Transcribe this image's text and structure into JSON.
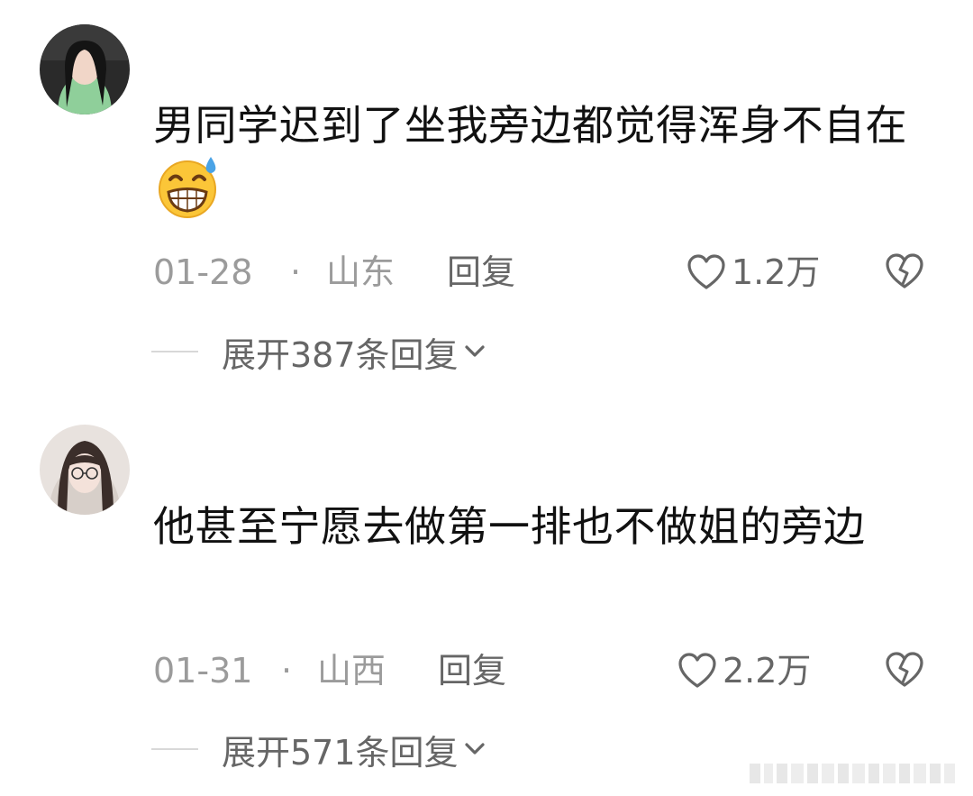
{
  "comments": [
    {
      "username": "",
      "text": "男同学迟到了坐我旁边都觉得浑身不自在",
      "emoji": "grinning-sweat-emoji",
      "date": "01-28",
      "separator": "·",
      "location": "山东",
      "reply_label": "回复",
      "likes": "1.2万",
      "expand_label": "展开387条回复"
    },
    {
      "username": "",
      "text": "他甚至宁愿去做第一排也不做姐的旁边",
      "date": "01-31",
      "separator": "·",
      "location": "山西",
      "reply_label": "回复",
      "likes": "2.2万",
      "expand_label": "展开571条回复"
    }
  ],
  "colors": {
    "text": "#111111",
    "meta": "#9b9b9b",
    "action": "#666666",
    "background": "#ffffff"
  }
}
